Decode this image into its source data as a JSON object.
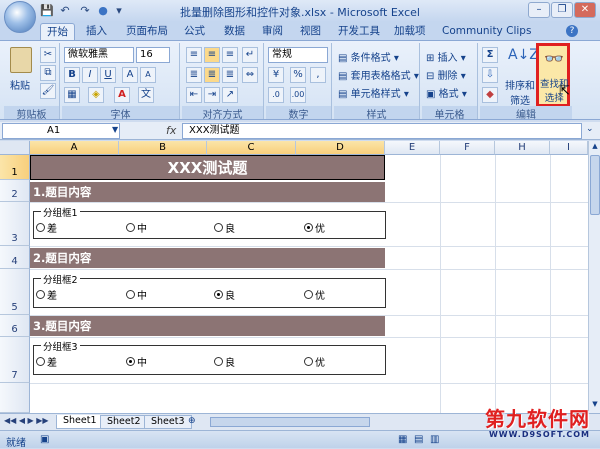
{
  "window": {
    "title": "批量删除图形和控件对象.xlsx - Microsoft Excel"
  },
  "qat": {
    "save": "💾",
    "undo": "↶",
    "redo": "↷",
    "circle": "●",
    "more": "▾"
  },
  "tabs": [
    "开始",
    "插入",
    "页面布局",
    "公式",
    "数据",
    "审阅",
    "视图",
    "开发工具",
    "加载项",
    "Community Clips"
  ],
  "ribbon": {
    "clipboard": {
      "paste": "粘贴",
      "label": "剪贴板"
    },
    "font": {
      "name": "微软雅黑",
      "size": "16",
      "bold": "B",
      "italic": "I",
      "underline": "U",
      "label": "字体"
    },
    "alignment": {
      "label": "对齐方式"
    },
    "number": {
      "format": "常规",
      "label": "数字"
    },
    "styles": {
      "conditional": "条件格式",
      "table": "套用表格格式",
      "cell": "单元格样式",
      "label": "样式"
    },
    "cells": {
      "insert": "插入",
      "delete": "删除",
      "format": "格式",
      "label": "单元格"
    },
    "editing": {
      "sigma": "Σ",
      "sort": "排序和",
      "sort2": "筛选",
      "find": "查找和",
      "find2": "选择",
      "label": "编辑"
    }
  },
  "formula_bar": {
    "name_box": "A1",
    "fx": "fx",
    "formula": "XXX测试题"
  },
  "columns": [
    "A",
    "B",
    "C",
    "D",
    "E",
    "F",
    "H",
    "I"
  ],
  "rows": [
    "1",
    "2",
    "3",
    "4",
    "5",
    "6",
    "7"
  ],
  "sheet": {
    "title": "XXX测试题",
    "sections": [
      {
        "heading": "1.题目内容",
        "group": "分组框1",
        "options": [
          "差",
          "中",
          "良",
          "优"
        ],
        "selected": 3
      },
      {
        "heading": "2.题目内容",
        "group": "分组框2",
        "options": [
          "差",
          "中",
          "良",
          "优"
        ],
        "selected": 2
      },
      {
        "heading": "3.题目内容",
        "group": "分组框3",
        "options": [
          "差",
          "中",
          "良",
          "优"
        ],
        "selected": 1
      }
    ]
  },
  "sheet_tabs": [
    "Sheet1",
    "Sheet2",
    "Sheet3"
  ],
  "status": {
    "ready": "就绪"
  },
  "watermark": {
    "brand": "第九软件网",
    "url": "WWW.D9SOFT.COM"
  },
  "colors": {
    "band": "#8c7474",
    "highlight": "#e02020"
  }
}
